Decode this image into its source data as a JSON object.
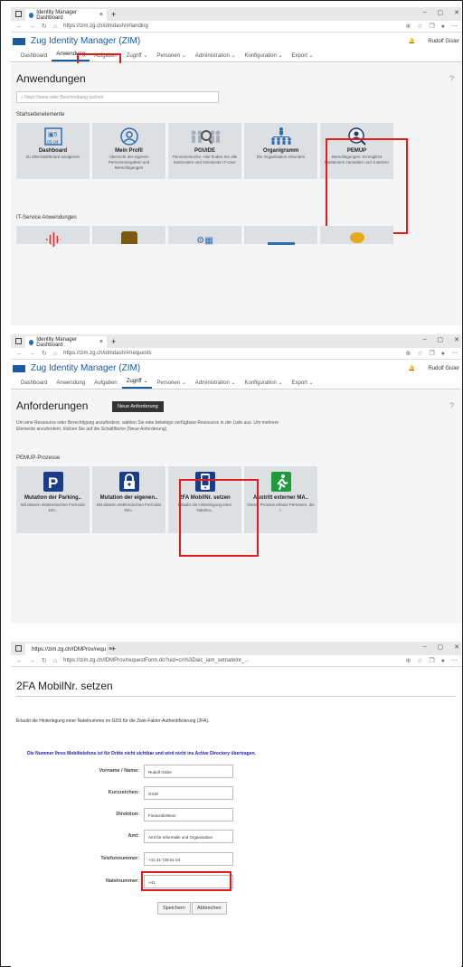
{
  "s1": {
    "tab_title": "Identity Manager Dashboard",
    "url": "https://zim.zg.ch/idmdash/#/landing",
    "app_title": "Zug Identity Manager (ZIM)",
    "user": "Rudolf Gisler",
    "nav": [
      "Dashboard",
      "Anwendung",
      "Aufgaben",
      "Zugriff",
      "Personen",
      "Administration",
      "Konfiguration",
      "Export"
    ],
    "heading": "Anwendungen",
    "search_placeholder": "Nach Name oder Beschreibung suchen",
    "section1": "Startseitenelemente",
    "tiles": [
      {
        "title": "Dashboard",
        "desc": "Zu ZIM-Dashboard navigieren"
      },
      {
        "title": "Mein Profil",
        "desc": "Übersicht der eigenen Personenangaben und Berechtigungen"
      },
      {
        "title": "PGUIDE",
        "desc": "Personensuche: Hier finden Sie alle kantonalen und Gemeinde IT-User"
      },
      {
        "title": "Organigramm",
        "desc": "Die Organisation erkunden"
      },
      {
        "title": "PEMUP",
        "desc": "Berechtigungen: Ermöglicht Mutationen zumelden und zusetzen"
      }
    ],
    "section2": "IT-Service Anwendungen"
  },
  "s2": {
    "tab_title": "Identity Manager Dashboard",
    "url": "https://zim.zg.ch/idmdash/#/requests",
    "app_title": "Zug Identity Manager (ZIM)",
    "user": "Rudolf Gisler",
    "nav": [
      "Dashboard",
      "Anwendung",
      "Aufgaben",
      "Zugriff",
      "Personen",
      "Administration",
      "Konfiguration",
      "Export"
    ],
    "heading": "Anforderungen",
    "new_request": "Neue Anforderung",
    "para": "Um eine Ressource oder Berechtigung anzufordern, wählen Sie eine beliebige verfügbare Ressource in der Liste aus. Um mehrere Elemente anzufordern, klicken Sie auf die Schaltfläche (Neue Anforderung).",
    "section": "PEMUP-Prozesse",
    "tiles": [
      {
        "title": "Mutation der Parking..",
        "desc": "Mit diesem elektronischen Formular kön.."
      },
      {
        "title": "Mutation der eigenen..",
        "desc": "Mit diesem elektronischen Formular kön.."
      },
      {
        "title": "2FA MobilNr. setzen",
        "desc": "Erlaubt die Hinterlegung einer Natelnu.."
      },
      {
        "title": "Austritt externer MA..",
        "desc": "Dieser Prozess erfasst Personen, die i.."
      }
    ]
  },
  "s3": {
    "tab_title": "https://zim.zg.ch/IDMProv/requ",
    "url": "https://zim.zg.ch/IDMProv/requestForm.do?uid=cn%3Daic_iam_setnatelnr_...",
    "title": "2FA MobilNr. setzen",
    "desc": "Erlaubt die Hinterlegung einer Natelnummer im GDS für die Zwei-Faktor-Authentifizierung (2FA).",
    "notice": "Die Nummer Ihres Mobiltelefons ist für Dritte nicht sichtbar und wird nicht ins Active Directory übertragen.",
    "fields": [
      {
        "label": "Vorname / Name:",
        "value": "Rudolf Gisler"
      },
      {
        "label": "Kurzzeichen:",
        "value": "GIUD"
      },
      {
        "label": "Direktion:",
        "value": "Finanzdirektion"
      },
      {
        "label": "Amt:",
        "value": "Amt für Informatik und Organisation"
      },
      {
        "label": "Telefonnummer:",
        "value": "+41 41 728 51 04"
      },
      {
        "label": "Natelnummer:",
        "value": "+41"
      }
    ],
    "save": "Speichern",
    "cancel": "Abbrechen"
  }
}
